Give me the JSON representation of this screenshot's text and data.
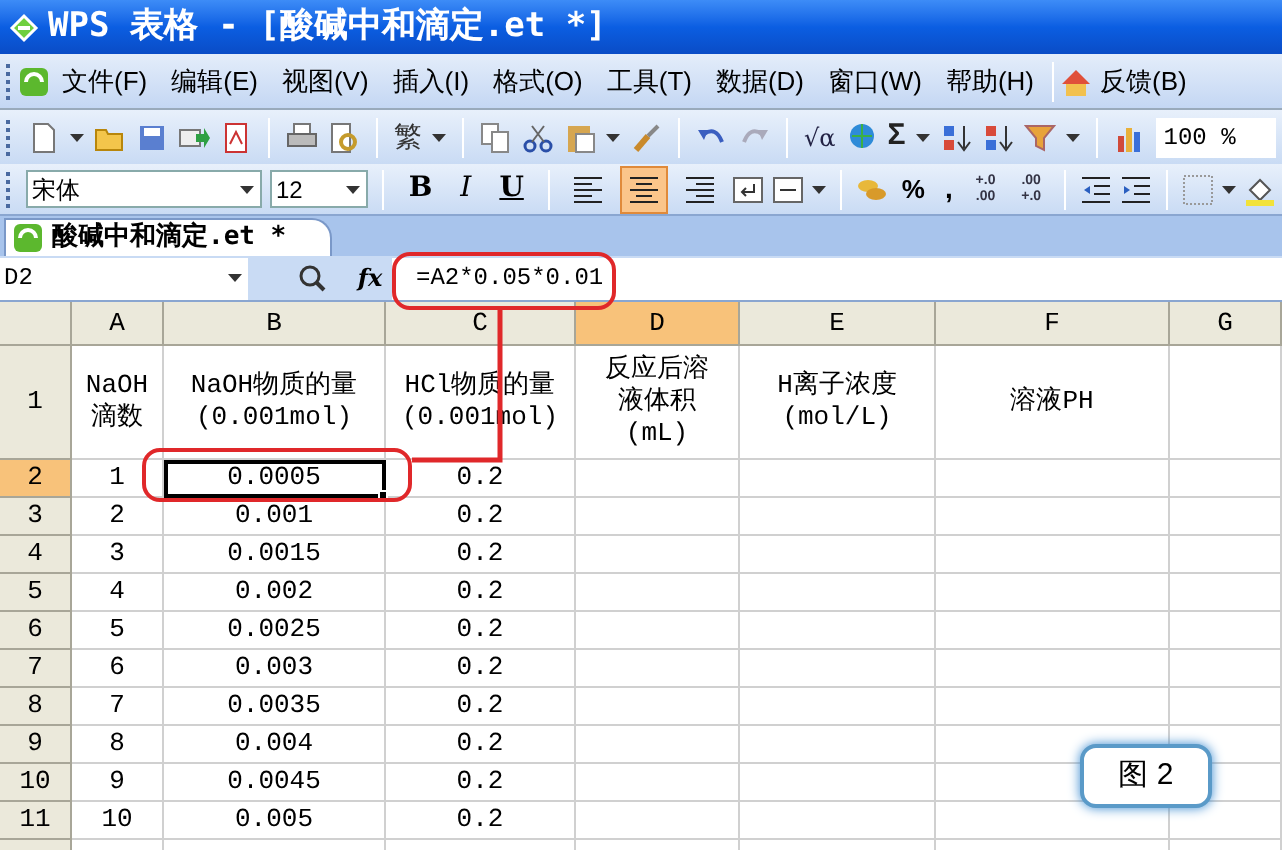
{
  "window": {
    "title": "WPS 表格 - [酸碱中和滴定.et *]"
  },
  "menu": [
    {
      "label": "文件(F)"
    },
    {
      "label": "编辑(E)"
    },
    {
      "label": "视图(V)"
    },
    {
      "label": "插入(I)"
    },
    {
      "label": "格式(O)"
    },
    {
      "label": "工具(T)"
    },
    {
      "label": "数据(D)"
    },
    {
      "label": "窗口(W)"
    },
    {
      "label": "帮助(H)"
    }
  ],
  "feedback": "反馈(B)",
  "standard_toolbar": {
    "traditional": "繁",
    "formula_tool": "√α",
    "sum": "Σ",
    "zoom": "100 %"
  },
  "format_toolbar": {
    "font": "宋体",
    "size": "12",
    "bold": "B",
    "italic": "I",
    "underline": "U",
    "align": [
      {
        "selected": false
      },
      {
        "selected": true
      },
      {
        "selected": false
      }
    ],
    "percent": "%",
    "comma": ",",
    "increase_decimal": "+.0 .00",
    "decrease_decimal": ".00 +.0"
  },
  "tabs": [
    {
      "label": "酸碱中和滴定.et *",
      "selected": true
    }
  ],
  "name_box": "D2",
  "fx": "fx",
  "formula": "=A2*0.05*0.01",
  "columns": [
    {
      "label": "A",
      "selected": false
    },
    {
      "label": "B",
      "selected": false
    },
    {
      "label": "C",
      "selected": false
    },
    {
      "label": "D",
      "selected": true
    },
    {
      "label": "E",
      "selected": false
    },
    {
      "label": "F",
      "selected": false
    },
    {
      "label": "G",
      "selected": false
    }
  ],
  "rows": [
    {
      "number": "1",
      "selected": false,
      "cells": [
        {
          "text": "NaOH\n滴数",
          "selected": false
        },
        {
          "text": "NaOH物质的量\n(0.001mol)",
          "selected": false
        },
        {
          "text": "HCl物质的量\n(0.001mol)",
          "selected": false
        },
        {
          "text": "反应后溶液体积(mL)",
          "selected": false
        },
        {
          "text": "H离子浓度\n(mol/L)",
          "selected": false
        },
        {
          "text": "溶液PH",
          "selected": false
        }
      ]
    },
    {
      "number": "2",
      "selected": true,
      "cells": [
        {
          "text": "1",
          "selected": false
        },
        {
          "text": "0.0005",
          "selected": true
        },
        {
          "text": "0.2",
          "selected": false
        }
      ]
    },
    {
      "number": "3",
      "selected": false,
      "cells": [
        {
          "text": "2",
          "selected": false
        },
        {
          "text": "0.001",
          "selected": false
        },
        {
          "text": "0.2",
          "selected": false
        }
      ]
    },
    {
      "number": "4",
      "selected": false,
      "cells": [
        {
          "text": "3",
          "selected": false
        },
        {
          "text": "0.0015",
          "selected": false
        },
        {
          "text": "0.2",
          "selected": false
        }
      ]
    },
    {
      "number": "5",
      "selected": false,
      "cells": [
        {
          "text": "4",
          "selected": false
        },
        {
          "text": "0.002",
          "selected": false
        },
        {
          "text": "0.2",
          "selected": false
        }
      ]
    },
    {
      "number": "6",
      "selected": false,
      "cells": [
        {
          "text": "5",
          "selected": false
        },
        {
          "text": "0.0025",
          "selected": false
        },
        {
          "text": "0.2",
          "selected": false
        }
      ]
    },
    {
      "number": "7",
      "selected": false,
      "cells": [
        {
          "text": "6",
          "selected": false
        },
        {
          "text": "0.003",
          "selected": false
        },
        {
          "text": "0.2",
          "selected": false
        }
      ]
    },
    {
      "number": "8",
      "selected": false,
      "cells": [
        {
          "text": "7",
          "selected": false
        },
        {
          "text": "0.0035",
          "selected": false
        },
        {
          "text": "0.2",
          "selected": false
        }
      ]
    },
    {
      "number": "9",
      "selected": false,
      "cells": [
        {
          "text": "8",
          "selected": false
        },
        {
          "text": "0.004",
          "selected": false
        },
        {
          "text": "0.2",
          "selected": false
        }
      ]
    },
    {
      "number": "10",
      "selected": false,
      "cells": [
        {
          "text": "9",
          "selected": false
        },
        {
          "text": "0.0045",
          "selected": false
        },
        {
          "text": "0.2",
          "selected": false
        }
      ]
    },
    {
      "number": "11",
      "selected": false,
      "cells": [
        {
          "text": "10",
          "selected": false
        },
        {
          "text": "0.005",
          "selected": false
        },
        {
          "text": "0.2",
          "selected": false
        }
      ]
    }
  ],
  "callout": "图 2"
}
